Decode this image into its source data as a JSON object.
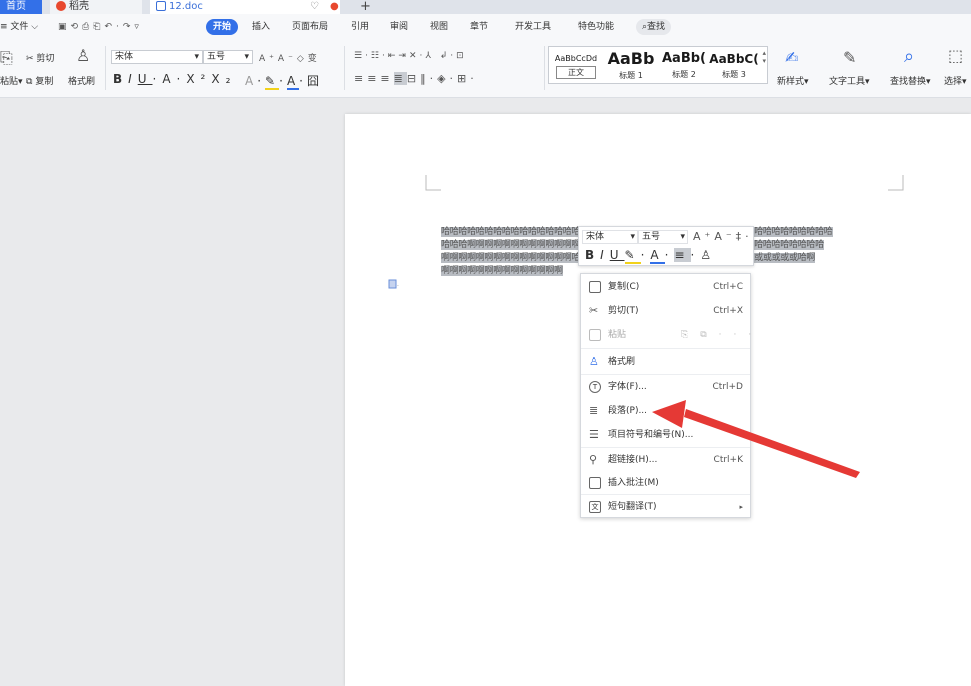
{
  "tabs": {
    "home": "首页",
    "daoke": "稻壳",
    "doc": "12.doc"
  },
  "menu": {
    "file": "文件",
    "start": "开始",
    "insert": "插入",
    "layout": "页面布局",
    "reference": "引用",
    "review": "审阅",
    "view": "视图",
    "section": "章节",
    "devtools": "开发工具",
    "special": "特色功能",
    "search": "查找"
  },
  "ribbon": {
    "paste": "粘贴",
    "cut": "剪切",
    "copy": "复制",
    "format_painter": "格式刷",
    "font": "宋体",
    "size": "五号",
    "styles": [
      {
        "preview": "AaBbCcDd",
        "label": "正文"
      },
      {
        "preview": "AaBb",
        "label": "标题 1"
      },
      {
        "preview": "AaBb(",
        "label": "标题 2"
      },
      {
        "preview": "AaBbC(",
        "label": "标题 3"
      }
    ],
    "new_style": "新样式",
    "text_tool": "文字工具",
    "find_replace": "查找替换",
    "select": "选择"
  },
  "document": {
    "lines": [
      "哈哈哈哈哈哈哈哈哈哈哈哈哈哈哈哈哈哈哈哈哈哈哈哈哈哈哈哈哈哈哈哈哈哈哈哈哈哈哈哈哈哈哈哈哈",
      "哈哈哈啊啊啊啊啊啊啊啊啊啊啊啊啊啊啊啊啊啊啊啊啊啊啊啊啊哈哈哈哈哈哈哈哈哈哈哈哈哈哈哈哈",
      "啊啊啊啊啊啊啊啊啊啊啊啊啊啊啊哈哈哈哈哈哈哈哈哈哈哈哈哈哈哈哈哈哈哈哈哈或或或或或哈啊",
      "啊啊啊啊啊啊啊啊啊啊啊啊啊啊"
    ]
  },
  "mini_toolbar": {
    "font": "宋体",
    "size": "五号"
  },
  "context_menu": {
    "items": [
      {
        "label": "复制(C)",
        "shortcut": "Ctrl+C"
      },
      {
        "label": "剪切(T)",
        "shortcut": "Ctrl+X"
      },
      {
        "label": "粘贴",
        "shortcut": ""
      },
      {
        "label": "格式刷",
        "shortcut": ""
      },
      {
        "label": "字体(F)...",
        "shortcut": "Ctrl+D"
      },
      {
        "label": "段落(P)...",
        "shortcut": ""
      },
      {
        "label": "项目符号和编号(N)...",
        "shortcut": ""
      },
      {
        "label": "超链接(H)...",
        "shortcut": "Ctrl+K"
      },
      {
        "label": "插入批注(M)",
        "shortcut": ""
      },
      {
        "label": "短句翻译(T)",
        "shortcut": ""
      }
    ]
  },
  "colors": {
    "accent": "#3370e8",
    "arrow": "#e53935",
    "selection": "#b8bcc2"
  }
}
